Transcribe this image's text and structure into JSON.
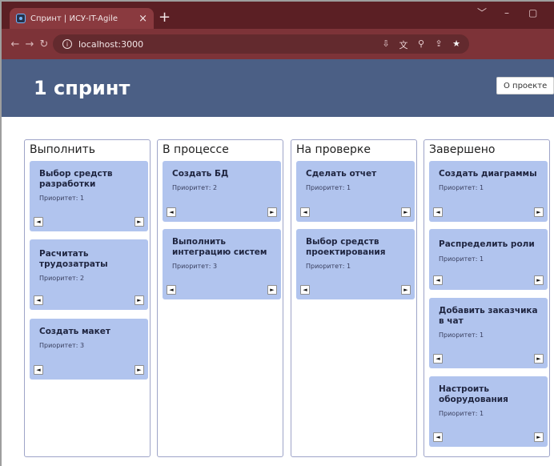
{
  "browser": {
    "tab_title": "Спринт | ИСУ-IT-Agile",
    "tab_close": "×",
    "new_tab": "+",
    "url": "localhost:3000",
    "window_controls": [
      "﹀",
      "–",
      "▢"
    ]
  },
  "header": {
    "title": "1 спринт",
    "about_button": "О проекте"
  },
  "columns": [
    {
      "title": "Выполнить",
      "cards": [
        {
          "title": "Выбор средств разработки",
          "priority": "Приоритет: 1"
        },
        {
          "title": "Расчитать трудозатраты",
          "priority": "Приоритет: 2"
        },
        {
          "title": "Создать макет",
          "priority": "Приоритет: 3"
        }
      ]
    },
    {
      "title": "В процессе",
      "cards": [
        {
          "title": "Создать БД",
          "priority": "Приоритет: 2"
        },
        {
          "title": "Выполнить интеграцию систем",
          "priority": "Приоритет: 3"
        }
      ]
    },
    {
      "title": "На проверке",
      "cards": [
        {
          "title": "Сделать отчет",
          "priority": "Приоритет: 1"
        },
        {
          "title": "Выбор средств проектирования",
          "priority": "Приоритет: 1"
        }
      ]
    },
    {
      "title": "Завершено",
      "cards": [
        {
          "title": "Создать диаграммы",
          "priority": "Приоритет: 1"
        },
        {
          "title": "Распределить роли",
          "priority": "Приоритет: 1"
        },
        {
          "title": "Добавить заказчика в чат",
          "priority": "Приоритет: 1"
        },
        {
          "title": "Настроить оборудования",
          "priority": "Приоритет: 1"
        }
      ]
    }
  ],
  "card_buttons": {
    "left": "◄",
    "right": "►"
  },
  "colors": {
    "header": "#4b5f85",
    "card": "#b1c4ee",
    "column_border": "#9ea4c8",
    "browser_frame": "#7d3338"
  }
}
